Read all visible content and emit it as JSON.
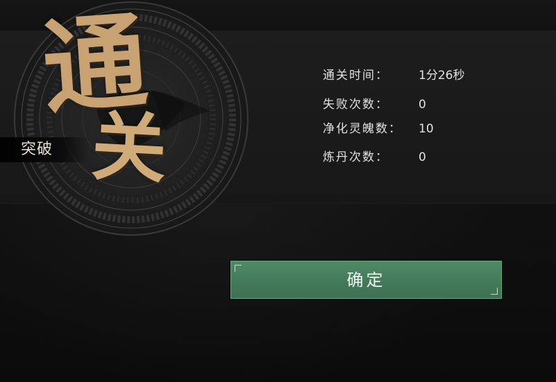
{
  "result": {
    "badge_title_char1": "通",
    "badge_title_char2": "关",
    "tag_label": "突破"
  },
  "stats": [
    {
      "label": "通关时间：",
      "value": "1分26秒"
    },
    {
      "label": "失败次数：",
      "value": "0"
    },
    {
      "label": "净化灵魄数：",
      "value": "10"
    },
    {
      "label": "炼丹次数：",
      "value": "0"
    }
  ],
  "confirm_button": {
    "label": "确定"
  },
  "colors": {
    "title_gold": "#c8a273",
    "button_green": "#4e8a66",
    "panel_bg": "#1d1d1d",
    "text_light": "#e2e2e2"
  }
}
